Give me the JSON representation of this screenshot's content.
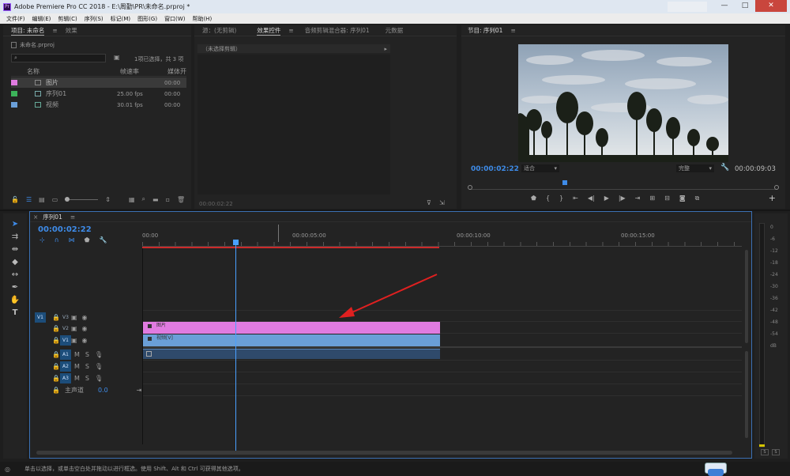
{
  "window": {
    "title": "Adobe Premiere Pro CC 2018 - E:\\周勤\\PR\\未命名.prproj *",
    "min": "—",
    "max": "□",
    "close": "✕"
  },
  "menu": [
    "文件(F)",
    "编辑(E)",
    "剪辑(C)",
    "序列(S)",
    "标记(M)",
    "图形(G)",
    "窗口(W)",
    "帮助(H)"
  ],
  "project": {
    "tab_active": "项目: 未命名",
    "tab_effects": "效果",
    "file": "未命名.prproj",
    "selection": "1项已选择，共 3 项",
    "col_name": "名称",
    "col_fps": "帧速率",
    "col_media": "媒体开",
    "items": [
      {
        "name": "图片",
        "fps": "",
        "media": "00:00",
        "color": "#e07be0"
      },
      {
        "name": "序列01",
        "fps": "25.00 fps",
        "media": "00:00",
        "color": "#3cb35a"
      },
      {
        "name": "视频",
        "fps": "30.01 fps",
        "media": "00:00",
        "color": "#6a9fd8"
      }
    ]
  },
  "source": {
    "tab_source": "源：(无剪辑)",
    "tab_effect_controls": "效果控件",
    "tab_audio_mixer": "音频剪辑混合器: 序列01",
    "tab_metadata": "元数据",
    "no_clip": "（未选择剪辑）",
    "timecode": "00:00:02:22"
  },
  "program": {
    "tab": "节目: 序列01",
    "timecode": "00:00:02:22",
    "fit": "适合",
    "quality": "完整",
    "duration": "00:00:09:03"
  },
  "timeline": {
    "tab": "序列01",
    "timecode": "00:00:02:22",
    "ruler": [
      "00:00",
      "00:00:05:00",
      "00:00:10:00",
      "00:00:15:00"
    ],
    "tracks_video": [
      "V3",
      "V2",
      "V1"
    ],
    "tracks_audio": [
      "A1",
      "A2",
      "A3"
    ],
    "master": "主声道",
    "master_val": "0.0",
    "clip_image": "图片",
    "clip_video": "视频[V]",
    "src_v1": "V1"
  },
  "meter": {
    "labels": [
      "0",
      "-6",
      "-12",
      "-18",
      "-24",
      "-30",
      "-36",
      "-42",
      "-48",
      "-54",
      "dB"
    ]
  },
  "statusbar": "单击以选择，或单击空白处并拖动以进行框选。使用 Shift、Alt 和 Ctrl 可获得其他选项。",
  "colors": {
    "accent": "#3e8be8",
    "playhead": "#4aa0ff",
    "image_clip": "#e07be0",
    "video_clip": "#6a9fd8",
    "workarea": "#cc2a2a"
  }
}
